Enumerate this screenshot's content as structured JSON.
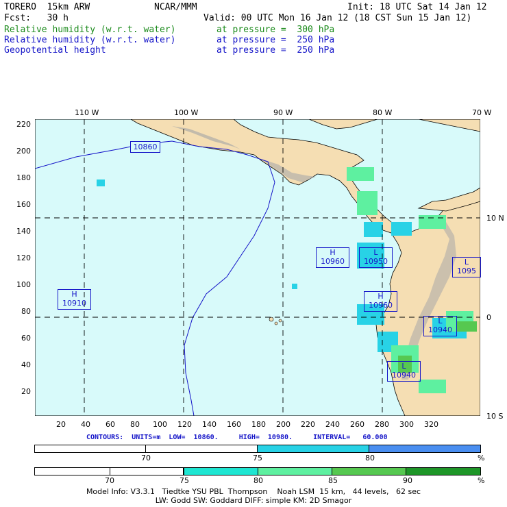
{
  "header": {
    "model": "TORERO  15km ARW",
    "org": "NCAR/MMM",
    "init": "Init: 18 UTC Sat 14 Jan 12",
    "fcst_label": "Fcst:   30 h",
    "valid": "Valid: 00 UTC Mon 16 Jan 12 (18 CST Sun 15 Jan 12)",
    "fields": [
      {
        "name": "Relative humidity (w.r.t. water)",
        "level": "at pressure =  300 hPa",
        "color": "#1a8a1a"
      },
      {
        "name": "Relative humidity (w.r.t. water)",
        "level": "at pressure =  250 hPa",
        "color": "#1414c8"
      },
      {
        "name": "Geopotential height",
        "level": "at pressure =  250 hPa",
        "color": "#1414c8"
      }
    ]
  },
  "map": {
    "top_lon_labels": [
      "110 W",
      "100 W",
      "90 W",
      "80 W",
      "70 W"
    ],
    "right_lat_labels": [
      "10 N",
      "0",
      "10 S"
    ],
    "left_y_ticks": [
      "220",
      "200",
      "180",
      "160",
      "140",
      "120",
      "100",
      "80",
      "60",
      "40",
      "20"
    ],
    "bottom_x_ticks": [
      "20",
      "40",
      "60",
      "80",
      "100",
      "120",
      "140",
      "160",
      "180",
      "200",
      "220",
      "240",
      "260",
      "280",
      "300",
      "320"
    ],
    "ocean_color": "#d8fafa",
    "land_color": "#f5deb3",
    "mountain_color": "#a8a8a8",
    "contour_labels": [
      "10860"
    ],
    "centers": [
      {
        "type": "H",
        "value": "10910"
      },
      {
        "type": "H",
        "value": "10960"
      },
      {
        "type": "L",
        "value": "10950"
      },
      {
        "type": "H",
        "value": "10960"
      },
      {
        "type": "L",
        "value": "10940"
      },
      {
        "type": "L",
        "value": "10940"
      },
      {
        "type": "L",
        "value": "1095"
      }
    ]
  },
  "contour_info": "CONTOURS:  UNITS=m  LOW=  10860.     HIGH=  10980.     INTERVAL=   60.000",
  "colorbar_250": {
    "labels": [
      "70",
      "75",
      "80",
      "%"
    ],
    "colors": [
      "#ffffff",
      "#ffffff",
      "#28d2e6",
      "#4a8ef0"
    ]
  },
  "colorbar_300": {
    "labels": [
      "70",
      "75",
      "80",
      "85",
      "90",
      "%"
    ],
    "colors": [
      "#ffffff",
      "#ffffff",
      "#ffffff",
      "#1ee6d2",
      "#5ef0a0",
      "#56c850",
      "#1e9628"
    ]
  },
  "footer": {
    "line1": "Model Info: V3.3.1   Tiedtke YSU PBL  Thompson    Noah LSM  15 km,   44 levels,   62 sec",
    "line2": "LW: Godd SW: Goddard DIFF: simple KM: 2D Smagor"
  }
}
